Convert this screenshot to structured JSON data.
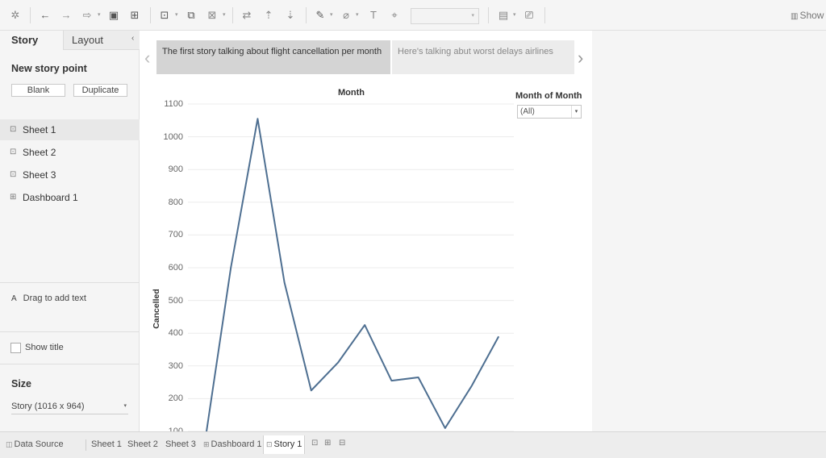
{
  "toolbar": {
    "show_label": "Show"
  },
  "panel": {
    "tabs": [
      {
        "label": "Story"
      },
      {
        "label": "Layout"
      }
    ],
    "new_story_point": "New story point",
    "blank_button": "Blank",
    "duplicate_button": "Duplicate",
    "sheets": [
      {
        "label": "Sheet 1",
        "icon": "sheet-icon"
      },
      {
        "label": "Sheet 2",
        "icon": "sheet-icon"
      },
      {
        "label": "Sheet 3",
        "icon": "sheet-icon"
      },
      {
        "label": "Dashboard 1",
        "icon": "dashboard-icon"
      }
    ],
    "drag_text": "Drag to add text",
    "show_title": "Show title",
    "size_heading": "Size",
    "size_value": "Story (1016 x 964)"
  },
  "story": {
    "points": [
      {
        "caption": "The first story talking about flight cancellation per month",
        "active": true
      },
      {
        "caption": "Here's talking abut worst delays airlines",
        "active": false
      }
    ]
  },
  "filter": {
    "title": "Month of Month",
    "value": "(All)"
  },
  "chart_data": {
    "type": "line",
    "title": "Month",
    "xlabel": "",
    "ylabel": "Cancelled",
    "y_ticks": [
      "1100",
      "1000",
      "900",
      "800",
      "700",
      "600",
      "500",
      "400",
      "300",
      "200",
      "100"
    ],
    "ylim": [
      100,
      1100
    ],
    "grid": true,
    "line_color": "#4e6f91",
    "series": [
      {
        "values": [
          50,
          600,
          1055,
          555,
          225,
          310,
          425,
          255,
          265,
          110,
          240,
          390
        ]
      }
    ]
  },
  "bottom_tabs": {
    "data_source": "Data Source",
    "sheets": [
      {
        "label": "Sheet 1"
      },
      {
        "label": "Sheet 2"
      },
      {
        "label": "Sheet 3"
      },
      {
        "label": "Dashboard 1"
      },
      {
        "label": "Story 1"
      }
    ]
  }
}
